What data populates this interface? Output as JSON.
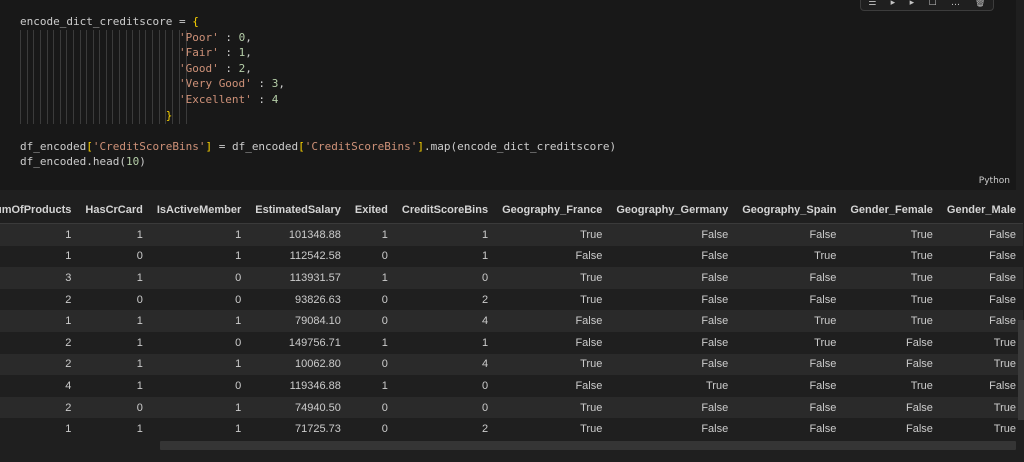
{
  "toolbar": {
    "icons": [
      "run-by-line-icon",
      "execute-above-icon",
      "execute-below-icon",
      "split-cell-icon",
      "more-icon",
      "delete-icon"
    ],
    "glyphs": [
      "☰",
      "▸",
      "▸",
      "☐",
      "…",
      "🗑"
    ]
  },
  "code": {
    "language": "Python",
    "var_dict": "encode_dict_creditscore",
    "eq": " = ",
    "brace_open": "{",
    "brace_close": "}",
    "items": [
      {
        "key": "'Poor'",
        "sep": " : ",
        "val": "0",
        "end": ","
      },
      {
        "key": "'Fair'",
        "sep": " : ",
        "val": "1",
        "end": ","
      },
      {
        "key": "'Good'",
        "sep": " : ",
        "val": "2",
        "end": ","
      },
      {
        "key": "'Very Good'",
        "sep": " : ",
        "val": "3",
        "end": ","
      },
      {
        "key": "'Excellent'",
        "sep": " : ",
        "val": "4",
        "end": ""
      }
    ],
    "line7_a": "df_encoded",
    "line7_key": "'CreditScoreBins'",
    "line7_mid": " = df_encoded",
    "line7_map": ".map(",
    "line7_arg": "encode_dict_creditscore",
    "line8_a": "df_encoded.head(",
    "line8_num": "10"
  },
  "table": {
    "headers": [
      "umOfProducts",
      "HasCrCard",
      "IsActiveMember",
      "EstimatedSalary",
      "Exited",
      "CreditScoreBins",
      "Geography_France",
      "Geography_Germany",
      "Geography_Spain",
      "Gender_Female",
      "Gender_Male"
    ],
    "rows": [
      [
        "1",
        "1",
        "1",
        "101348.88",
        "1",
        "1",
        "True",
        "False",
        "False",
        "True",
        "False"
      ],
      [
        "1",
        "0",
        "1",
        "112542.58",
        "0",
        "1",
        "False",
        "False",
        "True",
        "True",
        "False"
      ],
      [
        "3",
        "1",
        "0",
        "113931.57",
        "1",
        "0",
        "True",
        "False",
        "False",
        "True",
        "False"
      ],
      [
        "2",
        "0",
        "0",
        "93826.63",
        "0",
        "2",
        "True",
        "False",
        "False",
        "True",
        "False"
      ],
      [
        "1",
        "1",
        "1",
        "79084.10",
        "0",
        "4",
        "False",
        "False",
        "True",
        "True",
        "False"
      ],
      [
        "2",
        "1",
        "0",
        "149756.71",
        "1",
        "1",
        "False",
        "False",
        "True",
        "False",
        "True"
      ],
      [
        "2",
        "1",
        "1",
        "10062.80",
        "0",
        "4",
        "True",
        "False",
        "False",
        "False",
        "True"
      ],
      [
        "4",
        "1",
        "0",
        "119346.88",
        "1",
        "0",
        "False",
        "True",
        "False",
        "True",
        "False"
      ],
      [
        "2",
        "0",
        "1",
        "74940.50",
        "0",
        "0",
        "True",
        "False",
        "False",
        "False",
        "True"
      ],
      [
        "1",
        "1",
        "1",
        "71725.73",
        "0",
        "2",
        "True",
        "False",
        "False",
        "False",
        "True"
      ]
    ]
  }
}
